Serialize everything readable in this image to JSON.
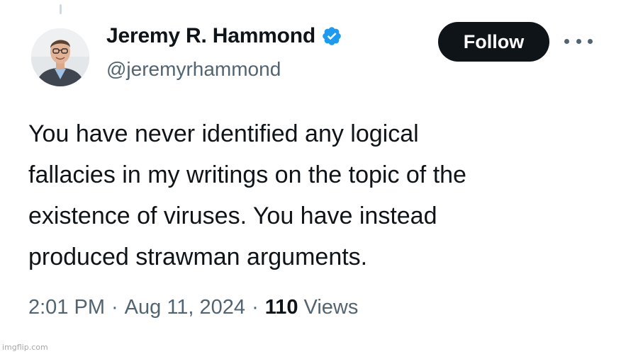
{
  "author": {
    "display_name": "Jeremy R. Hammond",
    "handle": "@jeremyrhammond",
    "verified": true
  },
  "actions": {
    "follow_label": "Follow"
  },
  "tweet": {
    "text_lines": [
      "You have never identified any logical",
      "fallacies in my writings on the topic of the",
      "existence of viruses. You have instead",
      "produced strawman arguments."
    ]
  },
  "meta": {
    "time": "2:01 PM",
    "separator": "·",
    "date": "Aug 11, 2024",
    "views_count": "110",
    "views_label": "Views"
  },
  "watermark": "imgflip.com",
  "colors": {
    "text_primary": "#0f1419",
    "text_secondary": "#536471",
    "verified_blue": "#1d9bf0",
    "follow_bg": "#0f1419"
  },
  "icons": {
    "verified": "verified-badge-icon",
    "more": "more-horizontal-icon"
  }
}
